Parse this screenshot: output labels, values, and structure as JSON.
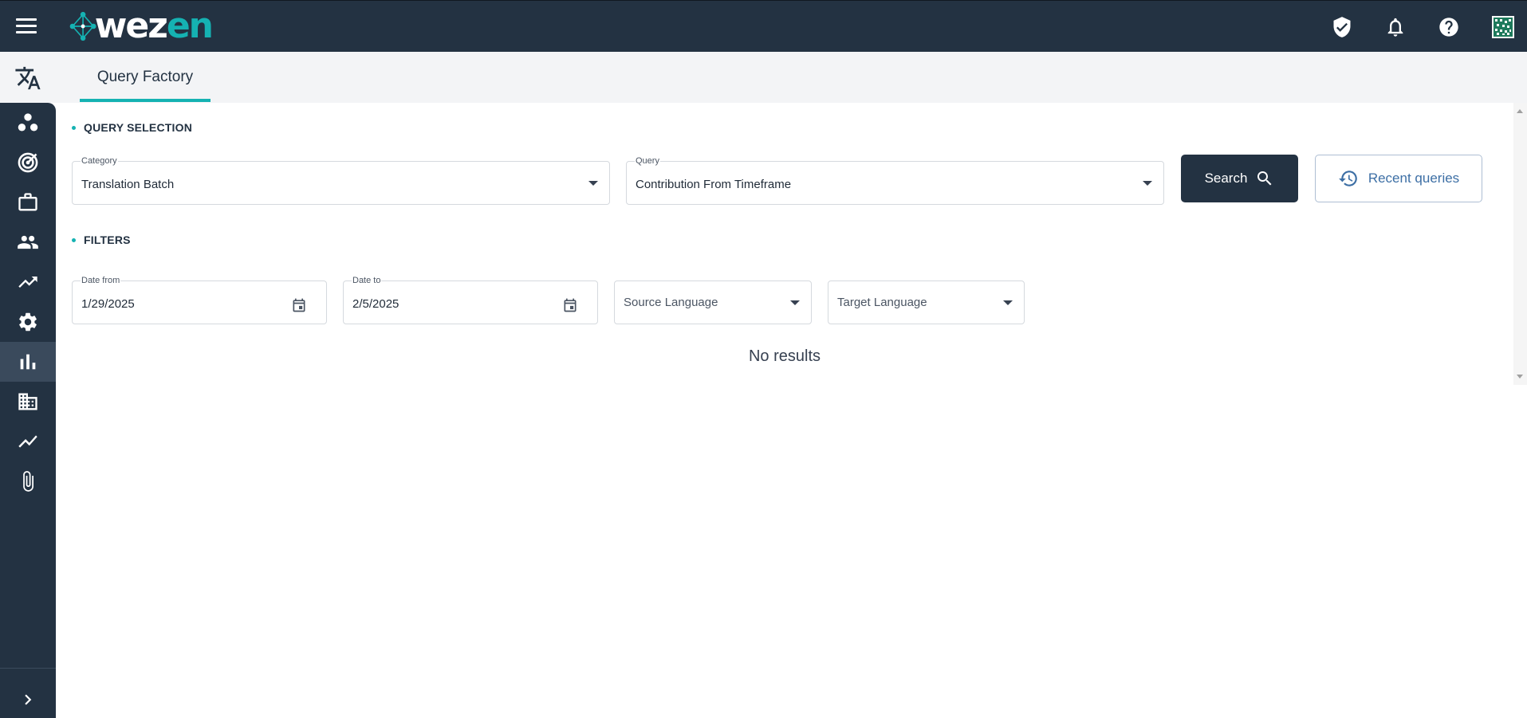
{
  "header": {
    "brand": {
      "prefix": "wez",
      "suffix": "en"
    },
    "icons": [
      "shield-check-icon",
      "bell-icon",
      "help-icon",
      "qr-code-icon"
    ]
  },
  "subheader": {
    "active_tab": "Query Factory"
  },
  "sidebar": {
    "items": [
      {
        "icon": "three-dots-icon"
      },
      {
        "icon": "target-icon"
      },
      {
        "icon": "briefcase-icon"
      },
      {
        "icon": "people-icon"
      },
      {
        "icon": "trending-up-icon"
      },
      {
        "icon": "gear-icon"
      },
      {
        "icon": "bar-chart-icon",
        "active": true
      },
      {
        "icon": "building-icon"
      },
      {
        "icon": "line-chart-icon"
      },
      {
        "icon": "paperclip-icon"
      }
    ],
    "expand_icon": "chevron-right-icon"
  },
  "query_selection": {
    "title": "QUERY SELECTION",
    "category": {
      "label": "Category",
      "value": "Translation Batch"
    },
    "query": {
      "label": "Query",
      "value": "Contribution From Timeframe"
    },
    "search_label": "Search",
    "recent_label": "Recent queries"
  },
  "filters": {
    "title": "FILTERS",
    "date_from": {
      "label": "Date from",
      "value": "1/29/2025"
    },
    "date_to": {
      "label": "Date to",
      "value": "2/5/2025"
    },
    "source_language": {
      "placeholder": "Source Language"
    },
    "target_language": {
      "placeholder": "Target Language"
    }
  },
  "results": {
    "empty_text": "No results"
  },
  "colors": {
    "header_bg": "#233242",
    "accent": "#15b2b2",
    "subheader_bg": "#f3f4f6",
    "recent_text": "#3d6fa5"
  }
}
